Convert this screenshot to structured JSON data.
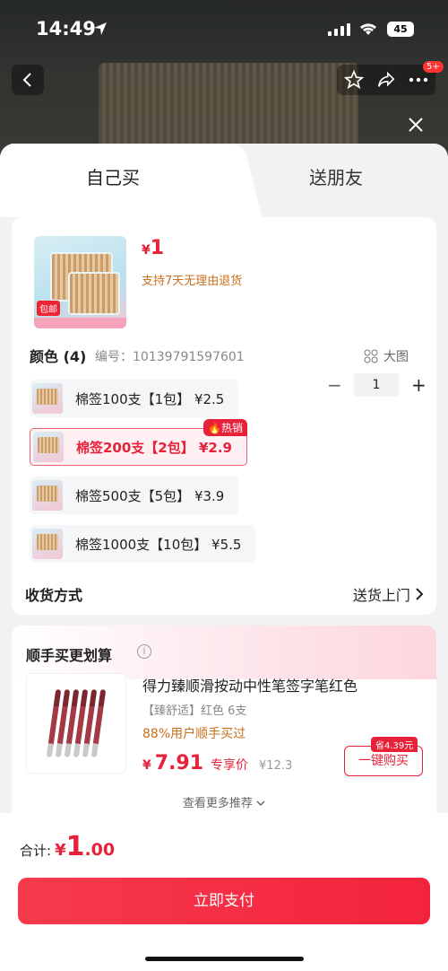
{
  "status": {
    "time": "14:49",
    "battery": "45"
  },
  "nav": {
    "badge": "5+"
  },
  "tabs": [
    {
      "label": "自己买"
    },
    {
      "label": "送朋友"
    }
  ],
  "product": {
    "price_symbol": "¥",
    "price": "1",
    "refund_note": "支持7天无理由退货",
    "image_tag": "包邮",
    "quantity": "1"
  },
  "variants": {
    "title": "颜色 (4)",
    "code": "编号：10139791597601",
    "big_image": "大图",
    "items": [
      {
        "label": "棉签100支【1包】 ¥2.5",
        "selected": false
      },
      {
        "label": "棉签200支【2包】 ¥2.9",
        "selected": true,
        "badge": "热销"
      },
      {
        "label": "棉签500支【5包】 ¥3.9",
        "selected": false
      },
      {
        "label": "棉签1000支【10包】 ¥5.5",
        "selected": false
      }
    ]
  },
  "shipping": {
    "label": "收货方式",
    "value": "送货上门"
  },
  "upsell": {
    "title": "顺手买更划算",
    "name": "得力臻顺滑按动中性笔签字笔红色",
    "spec": "【臻舒适】红色 6支",
    "bought": "88%用户顺手买过",
    "price_symbol": "¥",
    "price": "7.91",
    "price_tag": "专享价",
    "orig_price": "¥12.3",
    "save_tag": "省4.39元",
    "buy_label": "一键购买",
    "more": "查看更多推荐"
  },
  "footer": {
    "total_label": "合计:",
    "symbol": "¥",
    "integer": "1",
    "decimal": ".00",
    "pay_label": "立即支付"
  },
  "colors": {
    "accent": "#e8213b",
    "orange": "#c8701b"
  }
}
